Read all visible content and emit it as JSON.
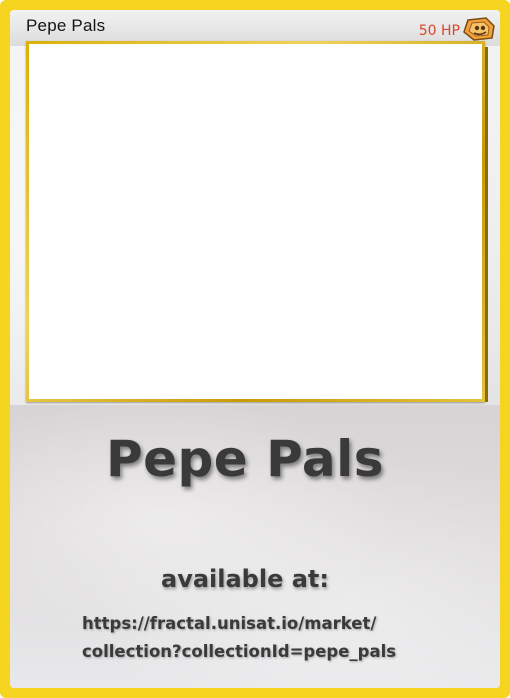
{
  "card": {
    "name": "Pepe Pals",
    "hp": "50 HP",
    "type_icon": "energy-type-icon",
    "colors": {
      "border": "#f5d51f",
      "frame_gold": "#d9b10a",
      "hp_red": "#d8462b",
      "text_dark": "#3a3a3a"
    }
  },
  "body": {
    "title": "Pepe Pals",
    "available_label": "available at:",
    "url_line1": "https://fractal.unisat.io/market/",
    "url_line2": "collection?collectionId=pepe_pals"
  }
}
